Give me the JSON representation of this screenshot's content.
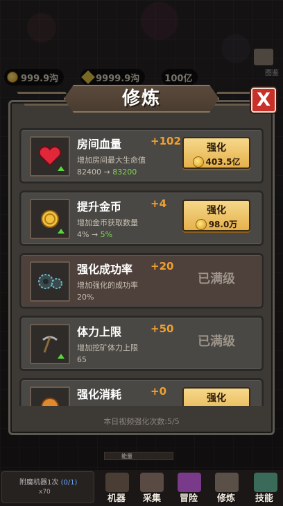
{
  "resources": {
    "gold": "999.9沟",
    "gems": "9999.9沟",
    "energy": "100亿",
    "book_label": "图鉴"
  },
  "modal": {
    "title": "修炼",
    "close_label": "X"
  },
  "upgrades": [
    {
      "name": "房间血量",
      "bonus": "+102",
      "desc": "增加房间最大生命值",
      "current": "82400",
      "arrow": "→",
      "next": "83200",
      "button_label": "强化",
      "cost": "403.5亿",
      "icon": "heart-icon",
      "maxed": false
    },
    {
      "name": "提升金币",
      "bonus": "+4",
      "desc": "增加金币获取数量",
      "current": "4%",
      "arrow": "→",
      "next": "5%",
      "button_label": "强化",
      "cost": "98.0万",
      "icon": "gold-coin-icon",
      "maxed": false
    },
    {
      "name": "强化成功率",
      "bonus": "+20",
      "desc": "增加强化的成功率",
      "current": "20%",
      "maxed_label": "已满级",
      "icon": "gears-icon",
      "maxed": true
    },
    {
      "name": "体力上限",
      "bonus": "+50",
      "desc": "增加挖矿体力上限",
      "current": "65",
      "maxed_label": "已满级",
      "icon": "pickaxe-icon",
      "maxed": true
    },
    {
      "name": "强化消耗",
      "bonus": "+0",
      "button_label": "强化",
      "icon": "orange-coin-icon",
      "maxed": false
    }
  ],
  "footer": {
    "video_count": "本日视频强化次数:5/5"
  },
  "bottom": {
    "machine_label": "附魔机器1次",
    "machine_count": "(0/1)",
    "machine_qty": "x70",
    "strip_label": "能量",
    "nav": [
      "机器",
      "采集",
      "冒险",
      "修炼",
      "技能"
    ]
  },
  "colors": {
    "accent_orange": "#f0a030",
    "next_value_green": "#7ed854",
    "button_gold": "#e6b14c",
    "close_red": "#c8302a"
  }
}
